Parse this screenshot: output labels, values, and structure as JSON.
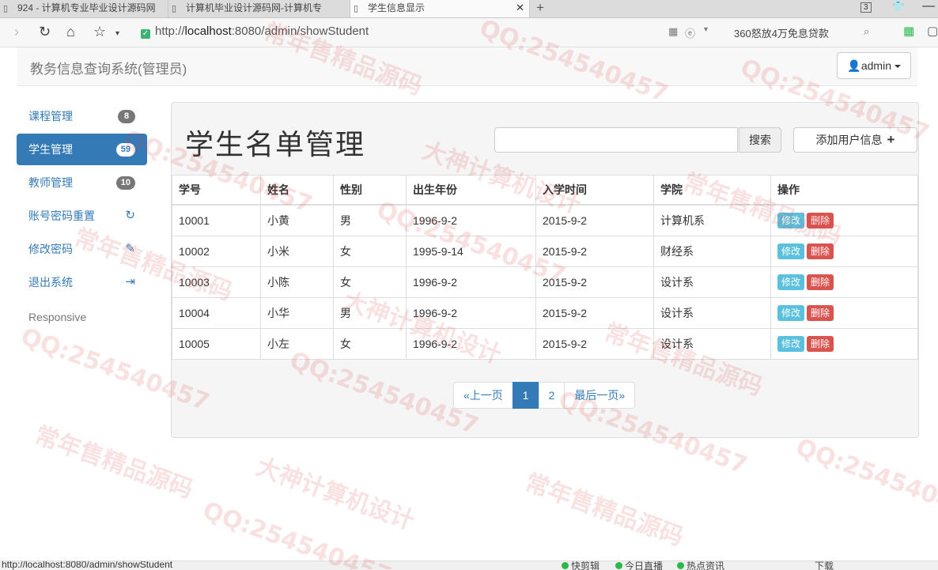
{
  "browser": {
    "tabs": [
      {
        "label": "924 - 计算机专业毕业设计源码网"
      },
      {
        "label": "计算机毕业设计源码网-计算机专"
      },
      {
        "label": "学生信息显示"
      }
    ],
    "new_tab": "+",
    "tab_count": "3",
    "close_tab": "✕",
    "url_prefix": "http://",
    "url_host": "localhost",
    "url_rest": ":8080/admin/showStudent",
    "ad_text": "360怒放4万免息贷款",
    "status_url": "http://localhost:8080/admin/showStudent",
    "status_items": [
      "快剪辑",
      "今日直播",
      "热点资讯",
      "下载"
    ]
  },
  "navbar": {
    "brand": "教务信息查询系统(管理员)",
    "user": "admin"
  },
  "sidebar": {
    "items": [
      {
        "label": "课程管理",
        "badge": "8",
        "icon": ""
      },
      {
        "label": "学生管理",
        "badge": "59",
        "icon": ""
      },
      {
        "label": "教师管理",
        "badge": "10",
        "icon": ""
      },
      {
        "label": "账号密码重置",
        "badge": "",
        "icon": "refresh-icon"
      },
      {
        "label": "修改密码",
        "badge": "",
        "icon": "pencil-icon"
      },
      {
        "label": "退出系统",
        "badge": "",
        "icon": "logout-icon"
      }
    ],
    "footer": "Responsive"
  },
  "main": {
    "title": "学生名单管理",
    "search_placeholder": "",
    "search_button": "搜索",
    "add_button": "添加用户信息",
    "table": {
      "headers": [
        "学号",
        "姓名",
        "性别",
        "出生年份",
        "入学时间",
        "学院",
        "操作"
      ],
      "rows": [
        [
          "10001",
          "小黄",
          "男",
          "1996-9-2",
          "2015-9-2",
          "计算机系"
        ],
        [
          "10002",
          "小米",
          "女",
          "1995-9-14",
          "2015-9-2",
          "财经系"
        ],
        [
          "10003",
          "小陈",
          "女",
          "1996-9-2",
          "2015-9-2",
          "设计系"
        ],
        [
          "10004",
          "小华",
          "男",
          "1996-9-2",
          "2015-9-2",
          "设计系"
        ],
        [
          "10005",
          "小左",
          "女",
          "1996-9-2",
          "2015-9-2",
          "设计系"
        ]
      ],
      "edit_label": "修改",
      "delete_label": "删除"
    },
    "pagination": [
      "«上一页",
      "1",
      "2",
      "最后一页»"
    ],
    "current_page": "1"
  },
  "watermarks": [
    "QQ:254540457",
    "大神计算机设计",
    "常年售精品源码"
  ],
  "colors": {
    "primary": "#337ab7",
    "edit": "#5bc0de",
    "delete": "#d9534f"
  }
}
